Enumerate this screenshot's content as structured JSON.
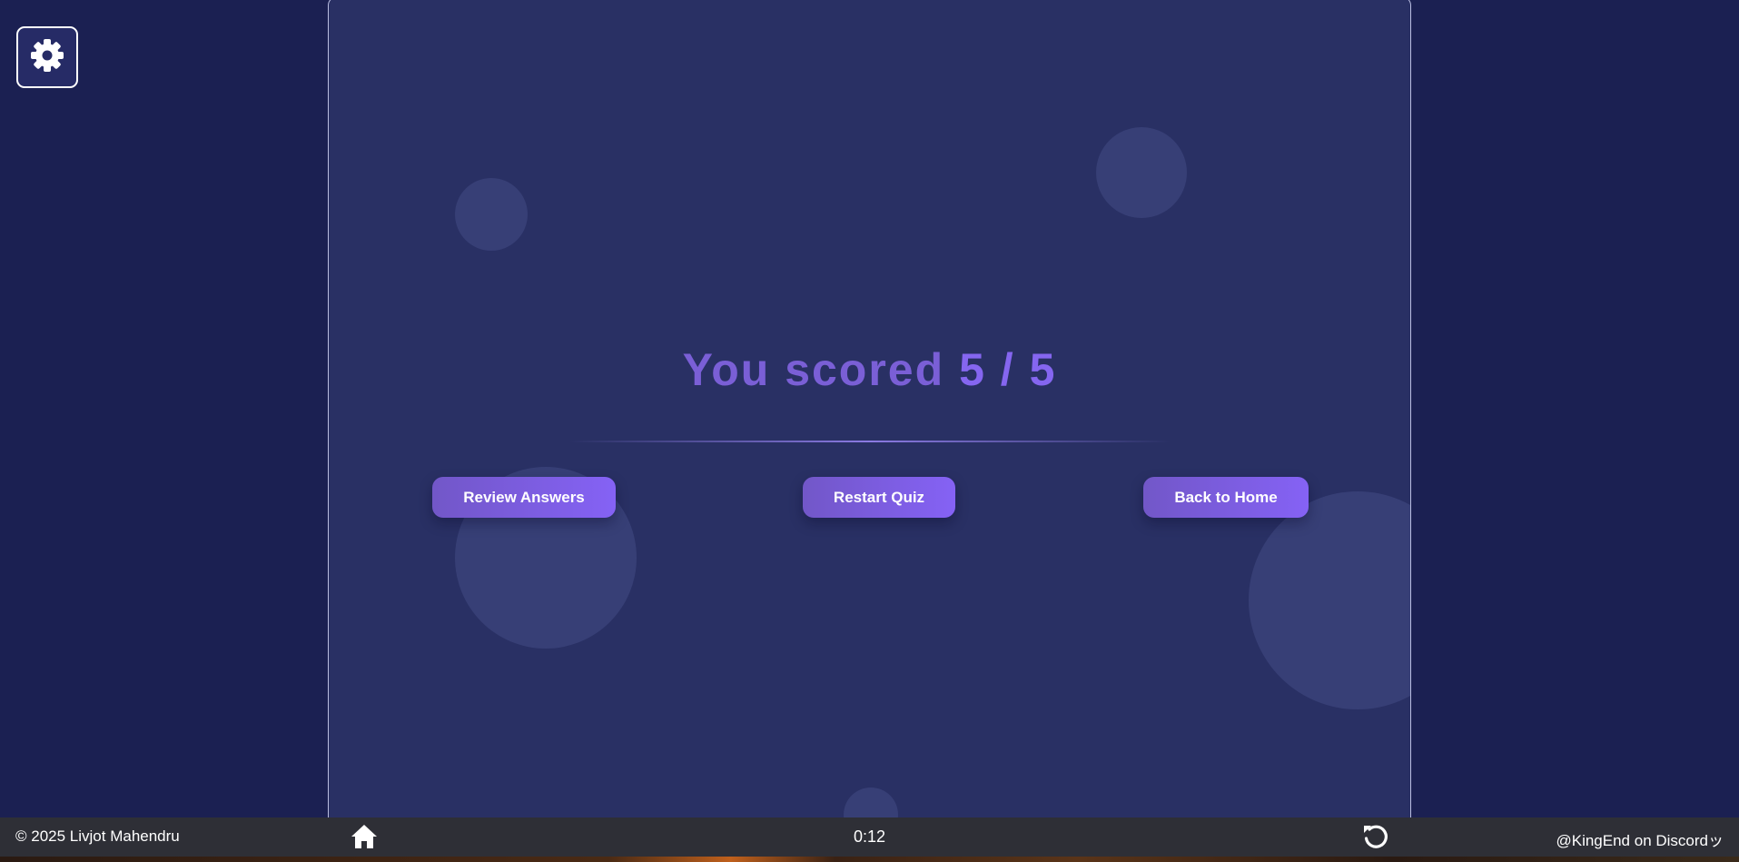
{
  "settings": {
    "icon": "gear-icon"
  },
  "result": {
    "prefix": "You scored",
    "score": "5",
    "separator": "/",
    "total": "5"
  },
  "actions": {
    "review_label": "Review Answers",
    "restart_label": "Restart Quiz",
    "home_label": "Back to Home"
  },
  "footer": {
    "copyright": "© 2025 Livjot Mahendru",
    "timer": "0:12",
    "discord": "@KingEnd on Discordッ",
    "home_icon": "home-icon",
    "restart_icon": "restart-icon"
  },
  "colors": {
    "background": "#1b2052",
    "card": "#293064",
    "accent": "#8562f5",
    "score_text": "#7a5fd6",
    "footer": "#2e2f36"
  }
}
